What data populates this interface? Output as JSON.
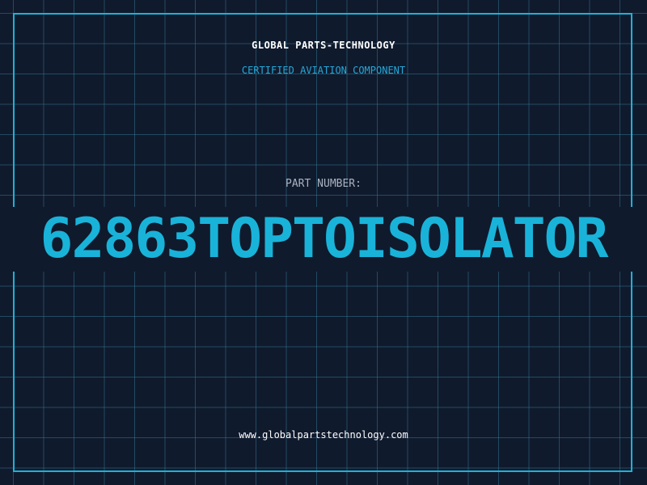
{
  "header": {
    "company": "GLOBAL PARTS-TECHNOLOGY",
    "subtitle": "CERTIFIED AVIATION COMPONENT"
  },
  "part": {
    "label": "PART NUMBER:",
    "number": "62863TOPTOISOLATOR"
  },
  "footer": {
    "url": "www.globalpartstechnology.com"
  },
  "colors": {
    "background": "#101a2d",
    "accent": "#19b3d9",
    "grid": "#387f9f",
    "label": "#a9b3c0",
    "text": "#ffffff"
  }
}
